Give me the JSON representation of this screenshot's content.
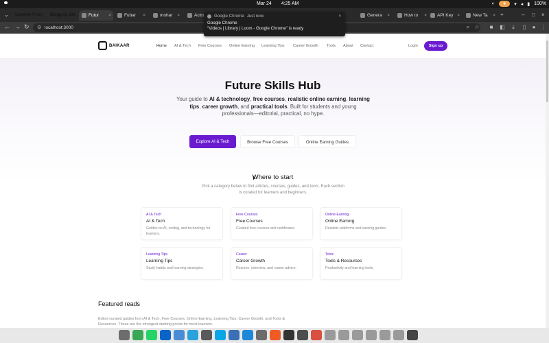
{
  "system": {
    "date": "Mar 24",
    "time": "4:25 AM",
    "battery": "100%"
  },
  "tabs": {
    "groups": [
      {
        "label": "Upwork-Fiverr",
        "color": "#7fd07a"
      },
      {
        "label": "Blogging site",
        "color": "#f0a24a"
      }
    ],
    "items": [
      {
        "label": "Futur",
        "active": true
      },
      {
        "label": "Fubar",
        "active": false
      },
      {
        "label": "mohar",
        "active": false
      },
      {
        "label": "Acco",
        "active": false
      },
      {
        "label": "Genera",
        "active": false
      },
      {
        "label": "How to",
        "active": false
      },
      {
        "label": "API Key",
        "active": false
      },
      {
        "label": "New Ta",
        "active": false
      }
    ]
  },
  "address": {
    "url": "localhost:3000"
  },
  "notification": {
    "app": "Google Chrome",
    "when": "Just now",
    "title": "Google Chrome",
    "message": "\"Videos | Library | Loom - Google Chrome\" is ready"
  },
  "site": {
    "logo": "BAIKAAR",
    "nav": [
      "Home",
      "AI & Tech",
      "Free Courses",
      "Online Earning",
      "Learning Tips",
      "Career Growth",
      "Tools",
      "About",
      "Contact"
    ],
    "login": "Login",
    "signup": "Sign up"
  },
  "hero": {
    "title": "Future Skills Hub",
    "sub_parts": [
      {
        "t": "Your guide to ",
        "b": false
      },
      {
        "t": "AI & technology",
        "b": true
      },
      {
        "t": ", ",
        "b": false
      },
      {
        "t": "free courses",
        "b": true
      },
      {
        "t": ", ",
        "b": false
      },
      {
        "t": "realistic online earning",
        "b": true
      },
      {
        "t": ", ",
        "b": false
      },
      {
        "t": "learning tips",
        "b": true
      },
      {
        "t": ", ",
        "b": false
      },
      {
        "t": "career growth",
        "b": true
      },
      {
        "t": ", and ",
        "b": false
      },
      {
        "t": "practical tools",
        "b": true
      },
      {
        "t": ". Built for students and young professionals—editorial, practical, no hype.",
        "b": false
      }
    ],
    "cta_primary": "Explore AI & Tech",
    "cta_courses": "Browse Free Courses",
    "cta_earning": "Online Earning Guides"
  },
  "start": {
    "title": "Where to start",
    "desc": "Pick a category below to find articles, courses, guides, and tools. Each section is curated for learners and beginners."
  },
  "cards": [
    {
      "tag": "AI & Tech",
      "title": "AI & Tech",
      "desc": "Guides on AI, coding, and technology for learners."
    },
    {
      "tag": "Free Courses",
      "title": "Free Courses",
      "desc": "Curated free courses and certificates."
    },
    {
      "tag": "Online Earning",
      "title": "Online Earning",
      "desc": "Realistic platforms and earning guides."
    },
    {
      "tag": "Learning Tips",
      "title": "Learning Tips",
      "desc": "Study habits and learning strategies."
    },
    {
      "tag": "Career",
      "title": "Career Growth",
      "desc": "Resume, interview, and career advice."
    },
    {
      "tag": "Tools",
      "title": "Tools & Resources",
      "desc": "Productivity and learning tools."
    }
  ],
  "featured": {
    "title": "Featured reads",
    "desc": "Editor-curated guides from AI & Tech, Free Courses, Online Earning, Learning Tips, Career Growth, and Tools & Resources. These are the strongest starting points for most learners."
  },
  "dock": {
    "apps": [
      {
        "icon": "files-icon",
        "color": "#6d6d6d"
      },
      {
        "icon": "chrome-icon",
        "color": "#3aa757"
      },
      {
        "icon": "whatsapp-icon",
        "color": "#25d366"
      },
      {
        "icon": "outlook-icon",
        "color": "#0a64c8"
      },
      {
        "icon": "globe-icon",
        "color": "#4a8bd6"
      },
      {
        "icon": "telegram-icon",
        "color": "#2aa3dc"
      },
      {
        "icon": "paint-icon",
        "color": "#5a5a5a"
      },
      {
        "icon": "skype-icon",
        "color": "#0aa5e6"
      },
      {
        "icon": "app-icon",
        "color": "#3b6fb6"
      },
      {
        "icon": "vscode-icon",
        "color": "#1e88d8"
      },
      {
        "icon": "vim-icon",
        "color": "#6c6c6c"
      },
      {
        "icon": "postman-icon",
        "color": "#ef5b25"
      },
      {
        "icon": "terminal-icon",
        "color": "#333333"
      },
      {
        "icon": "cutter-icon",
        "color": "#4d4d4d"
      },
      {
        "icon": "chrome-active-icon",
        "color": "#d8503f"
      },
      {
        "icon": "window-icon",
        "color": "#9a9a9a"
      },
      {
        "icon": "window-icon",
        "color": "#9a9a9a"
      },
      {
        "icon": "window-icon",
        "color": "#9a9a9a"
      },
      {
        "icon": "window-icon",
        "color": "#9a9a9a"
      },
      {
        "icon": "window-icon",
        "color": "#9a9a9a"
      },
      {
        "icon": "window-icon",
        "color": "#9a9a9a"
      },
      {
        "icon": "settings-icon",
        "color": "#444444"
      }
    ]
  }
}
